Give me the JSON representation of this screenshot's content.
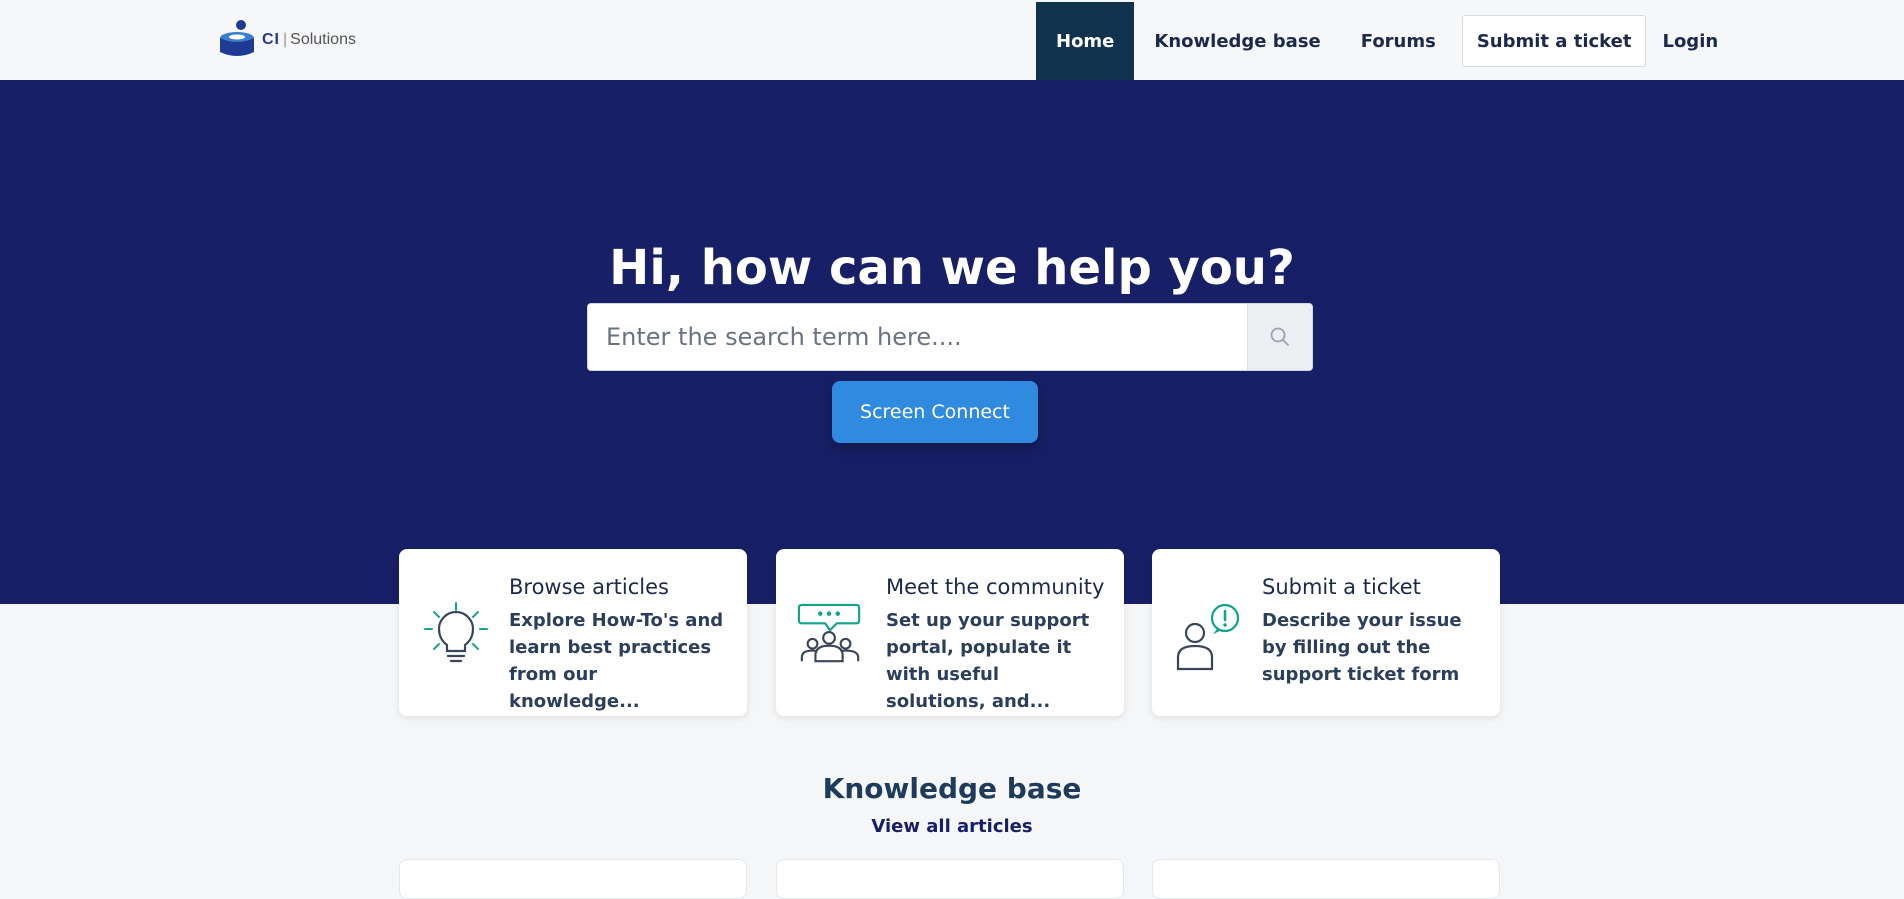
{
  "header": {
    "logo": {
      "brand_mark": "CI",
      "brand_name": "Solutions"
    },
    "nav": [
      {
        "label": "Home",
        "active": true
      },
      {
        "label": "Knowledge base",
        "active": false
      },
      {
        "label": "Forums",
        "active": false
      },
      {
        "label": "Submit a ticket",
        "active": false
      },
      {
        "label": "Login",
        "active": false
      }
    ]
  },
  "hero": {
    "title": "Hi, how can we help you?",
    "search": {
      "placeholder": "Enter the search term here....",
      "value": "",
      "icon": "search-icon"
    },
    "screen_connect_label": "Screen Connect"
  },
  "cards": [
    {
      "title": "Browse articles",
      "description": "Explore How-To's and learn best practices from our knowledge...",
      "icon": "lightbulb-icon"
    },
    {
      "title": "Meet the community",
      "description": "Set up your support portal, populate it with useful solutions, and...",
      "icon": "community-icon"
    },
    {
      "title": "Submit a ticket",
      "description": "Describe your issue by filling out the support ticket form",
      "icon": "person-alert-icon"
    }
  ],
  "knowledge_base": {
    "title": "Knowledge base",
    "view_all_label": "View all articles"
  },
  "colors": {
    "hero_bg": "#172066",
    "active_nav": "#10324c",
    "accent_button": "#2f8ae0",
    "icon_green": "#12a38a",
    "icon_gray": "#4a5568"
  }
}
